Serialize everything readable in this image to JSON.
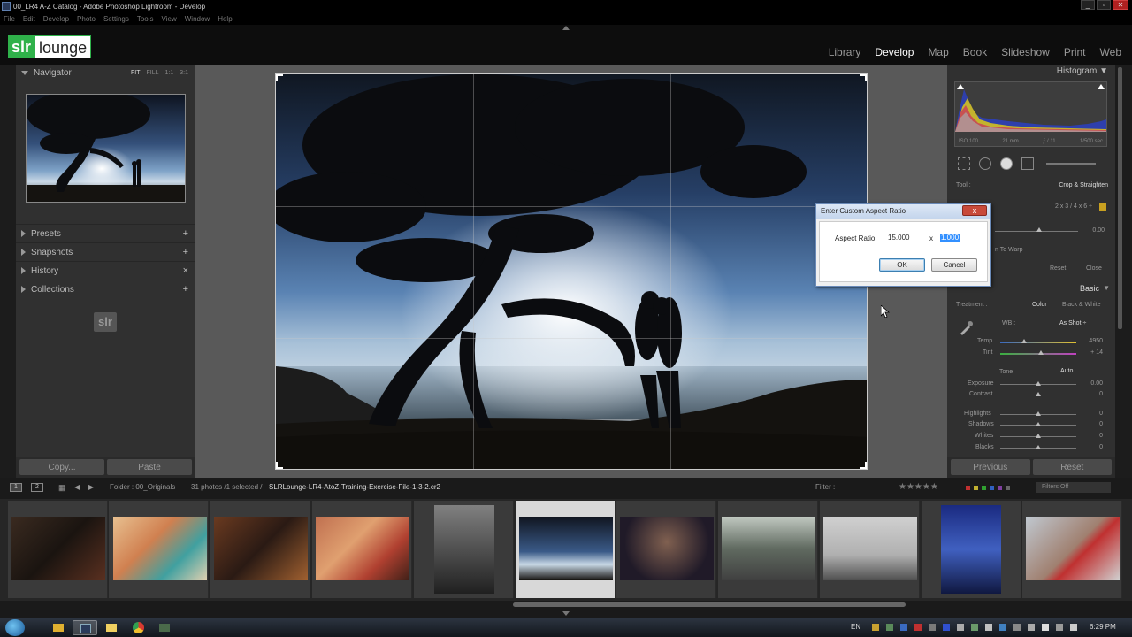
{
  "window": {
    "title": "00_LR4 A-Z Catalog - Adobe Photoshop Lightroom - Develop",
    "menu": [
      "File",
      "Edit",
      "Develop",
      "Photo",
      "Settings",
      "Tools",
      "View",
      "Window",
      "Help"
    ]
  },
  "header": {
    "logo_left": "slr",
    "logo_right": "lounge",
    "modules": [
      "Library",
      "Develop",
      "Map",
      "Book",
      "Slideshow",
      "Print",
      "Web"
    ],
    "active_module": "Develop"
  },
  "left_panel": {
    "navigator_title": "Navigator",
    "zoom_options": [
      "FIT",
      "FILL",
      "1:1",
      "3:1"
    ],
    "sections": [
      {
        "label": "Presets",
        "action": "+"
      },
      {
        "label": "Snapshots",
        "action": "+"
      },
      {
        "label": "History",
        "action": "×"
      },
      {
        "label": "Collections",
        "action": "+"
      }
    ],
    "watermark": "slr",
    "copy_label": "Copy...",
    "paste_label": "Paste"
  },
  "right_panel": {
    "histogram_title": "Histogram",
    "hist_info": [
      "ISO 100",
      "21 mm",
      "ƒ / 11",
      "1/500 sec"
    ],
    "tool_label": "Tool :",
    "tool_name": "Crop & Straighten",
    "aspect": "2 x 3 / 4 x 6 ÷",
    "angle_value": "0.00",
    "constrain_warp": "n To Warp",
    "reset_label": "Reset",
    "close_label": "Close",
    "basic_title": "Basic",
    "treatment_label": "Treatment :",
    "treatment_color": "Color",
    "treatment_bw": "Black & White",
    "wb_label": "WB :",
    "wb_value": "As Shot ÷",
    "temp_label": "Temp",
    "temp_value": "4950",
    "tint_label": "Tint",
    "tint_value": "+ 14",
    "tone_label": "Tone",
    "auto_label": "Auto",
    "exposure_label": "Exposure",
    "exposure_value": "0.00",
    "contrast_label": "Contrast",
    "contrast_value": "0",
    "highlights_label": "Highlights",
    "highlights_value": "0",
    "shadows_label": "Shadows",
    "shadows_value": "0",
    "whites_label": "Whites",
    "whites_value": "0",
    "blacks_label": "Blacks",
    "blacks_value": "0",
    "previous_label": "Previous",
    "reset_bottom_label": "Reset"
  },
  "dialog": {
    "title": "Enter Custom Aspect Ratio",
    "close_glyph": "x",
    "label": "Aspect Ratio:",
    "value1": "15.000",
    "separator": "x",
    "value2": "1.000",
    "ok_label": "OK",
    "cancel_label": "Cancel"
  },
  "filmbar": {
    "view1": "1",
    "view2": "2",
    "folder": "Folder : 00_Originals",
    "count": "31 photos /1 selected /",
    "filename": "SLRLounge-LR4-AtoZ-Training-Exercise-File-1-3-2.cr2",
    "filter_label": "Filter :",
    "stars": "★★★★★",
    "filters_off": "Filters Off"
  },
  "taskbar": {
    "language": "EN",
    "time": "6:29 PM"
  },
  "colors": {
    "logo_green": "#2fb14a",
    "panel_bg": "#303030",
    "workspace_bg": "#595959",
    "selection_blue": "#3390ff",
    "close_red": "#c84a3a"
  }
}
